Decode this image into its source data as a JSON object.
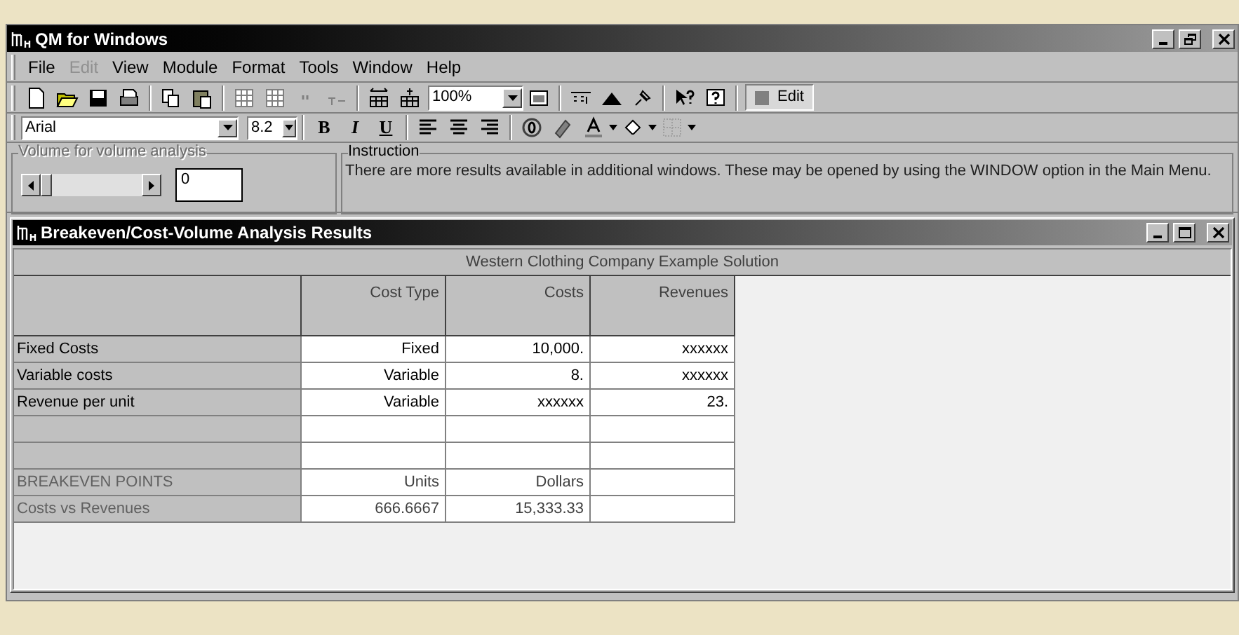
{
  "window": {
    "title": "QM for Windows"
  },
  "menu": [
    {
      "label": "File",
      "disabled": false
    },
    {
      "label": "Edit",
      "disabled": true
    },
    {
      "label": "View",
      "disabled": false
    },
    {
      "label": "Module",
      "disabled": false
    },
    {
      "label": "Format",
      "disabled": false
    },
    {
      "label": "Tools",
      "disabled": false
    },
    {
      "label": "Window",
      "disabled": false
    },
    {
      "label": "Help",
      "disabled": false
    }
  ],
  "toolbar": {
    "zoom": "100%",
    "edit_button": "Edit"
  },
  "format_bar": {
    "font": "Arial",
    "size": "8.2",
    "bold": "B",
    "italic": "I",
    "underline": "U"
  },
  "volume": {
    "title": "Volume for volume analysis",
    "disabled": true,
    "value": "0"
  },
  "instruction": {
    "title": "Instruction",
    "text": "There are more results available in additional windows. These may be opened by using the WINDOW option in the Main Menu."
  },
  "results_window": {
    "title": "Breakeven/Cost-Volume Analysis Results",
    "caption": "Western Clothing Company Example Solution",
    "columns": [
      "Cost Type",
      "Costs",
      "Revenues"
    ],
    "rows": [
      {
        "kind": "data",
        "label": "Fixed Costs",
        "dimmed": false,
        "cells": [
          "Fixed",
          "10,000.",
          "xxxxxx"
        ]
      },
      {
        "kind": "data",
        "label": "Variable costs",
        "dimmed": false,
        "cells": [
          "Variable",
          "8.",
          "xxxxxx"
        ]
      },
      {
        "kind": "data",
        "label": "Revenue per unit",
        "dimmed": false,
        "cells": [
          "Variable",
          "xxxxxx",
          "23."
        ]
      },
      {
        "kind": "blank"
      },
      {
        "kind": "blank"
      },
      {
        "kind": "data",
        "label": "BREAKEVEN POINTS",
        "dimmed": true,
        "cells": [
          "Units",
          "Dollars"
        ]
      },
      {
        "kind": "data",
        "label": "Costs vs Revenues",
        "dimmed": true,
        "cells": [
          "666.6667",
          "15,333.33"
        ]
      }
    ]
  }
}
